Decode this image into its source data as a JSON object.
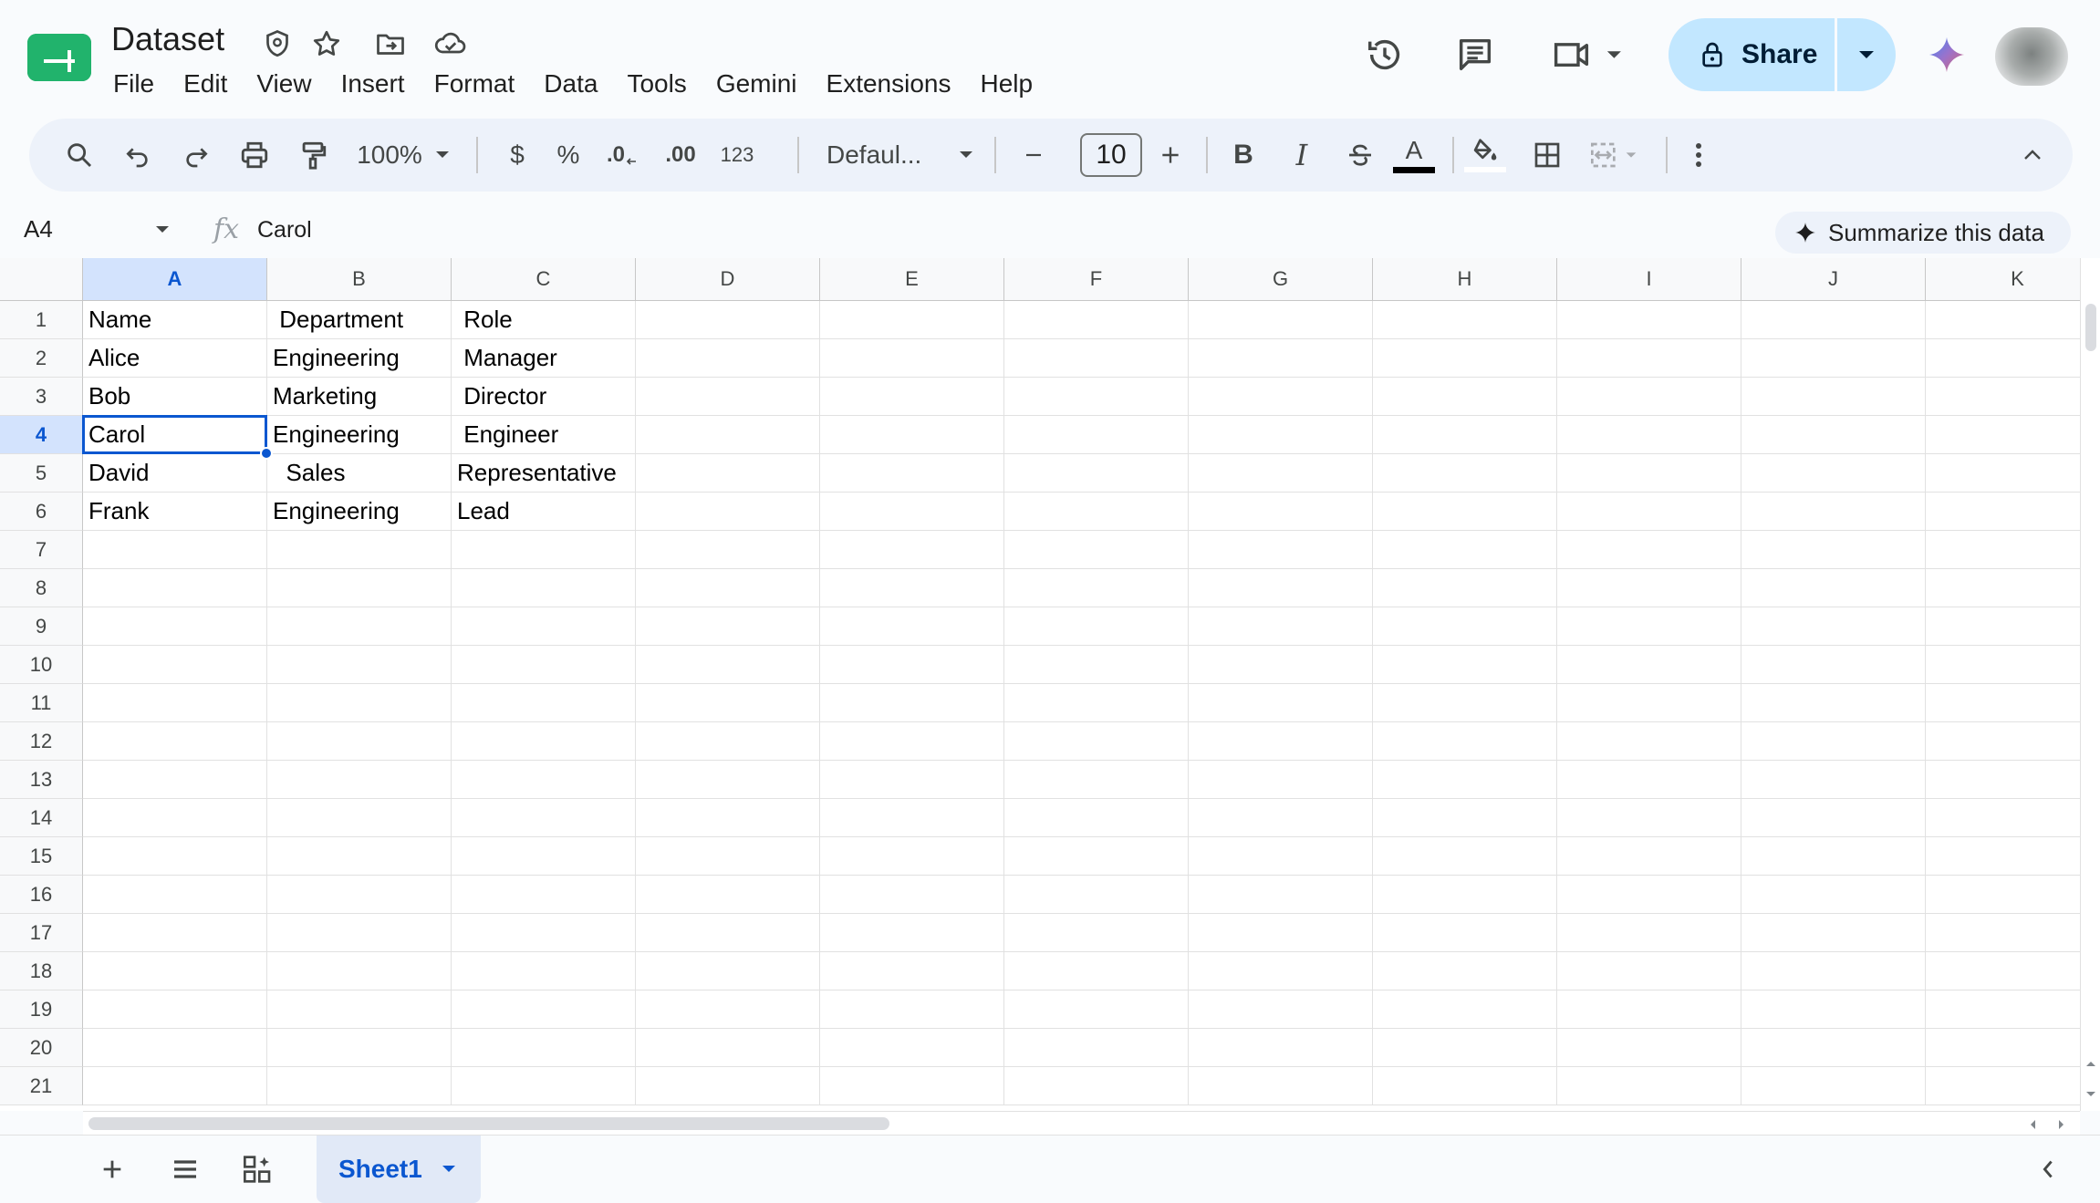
{
  "app": {
    "doc_title": "Dataset",
    "menus": [
      "File",
      "Edit",
      "View",
      "Insert",
      "Format",
      "Data",
      "Tools",
      "Gemini",
      "Extensions",
      "Help"
    ],
    "share_label": "Share"
  },
  "toolbar": {
    "zoom": "100%",
    "currency": "$",
    "percent": "%",
    "decrease_decimal": ".0",
    "increase_decimal": ".00",
    "number_format": "123",
    "font_family": "Defaul...",
    "font_size": "10"
  },
  "formula_bar": {
    "cell_ref": "A4",
    "fx": "fx",
    "value": "Carol",
    "summarize_label": "Summarize this data"
  },
  "grid": {
    "columns": [
      "A",
      "B",
      "C",
      "D",
      "E",
      "F",
      "G",
      "H",
      "I",
      "J",
      "K"
    ],
    "rows": [
      "1",
      "2",
      "3",
      "4",
      "5",
      "6",
      "7",
      "8",
      "9",
      "10",
      "11",
      "12",
      "13",
      "14",
      "15",
      "16",
      "17",
      "18",
      "19",
      "20",
      "21"
    ],
    "selected_cell": "A4",
    "cells": [
      [
        "Name",
        " Department",
        " Role"
      ],
      [
        "Alice",
        "Engineering",
        " Manager"
      ],
      [
        "Bob",
        "Marketing",
        " Director"
      ],
      [
        "Carol",
        "Engineering",
        " Engineer"
      ],
      [
        "David",
        "  Sales",
        "Representative"
      ],
      [
        "Frank",
        "Engineering",
        "Lead"
      ]
    ]
  },
  "sheets": {
    "active": "Sheet1"
  },
  "colors": {
    "accent": "#0b57d0",
    "share_bg": "#c2e7ff",
    "toolbar_bg": "#edf2fa",
    "logo_green": "#0f9d58"
  }
}
